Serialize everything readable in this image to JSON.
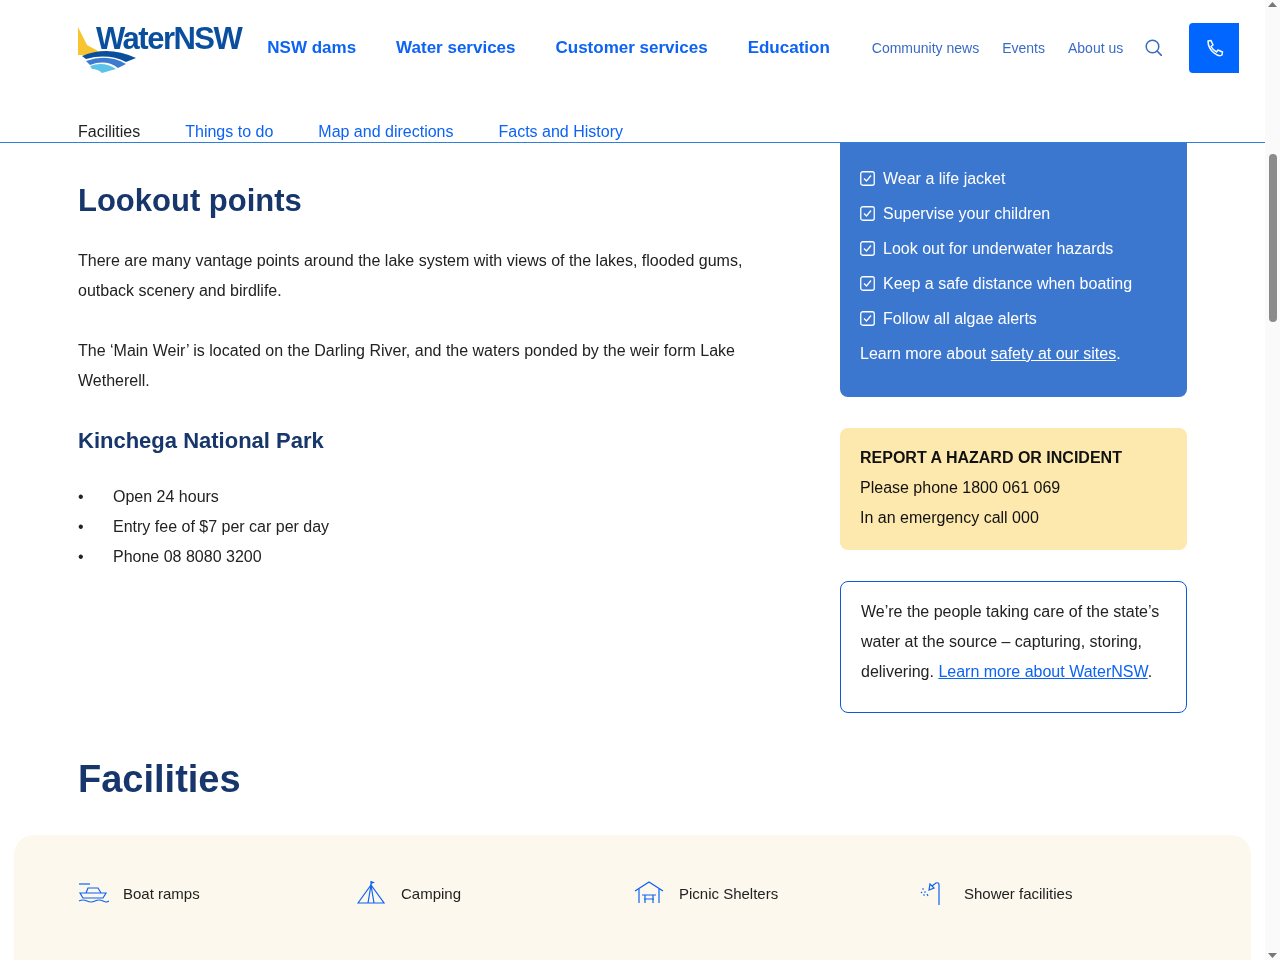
{
  "header": {
    "logo": "WaterNSW",
    "main_nav": [
      "NSW dams",
      "Water services",
      "Customer services",
      "Education"
    ],
    "secondary_nav": [
      "Community news",
      "Events",
      "About us"
    ]
  },
  "tabs": [
    {
      "label": "Facilities",
      "selected": true
    },
    {
      "label": "Things to do",
      "selected": false
    },
    {
      "label": "Map and directions",
      "selected": false
    },
    {
      "label": "Facts and History",
      "selected": false
    }
  ],
  "content": {
    "heading": "Lookout points",
    "paragraphs": [
      "There are many vantage points around the lake system with views of the lakes, flooded gums, outback scenery and birdlife.",
      "The ‘Main Weir’ is located on the Darling River, and the waters ponded by the weir form Lake Wetherell."
    ],
    "subheading": "Kinchega National Park",
    "bullets": [
      {
        "marker": "•",
        "text": "Open 24 hours"
      },
      {
        "marker": "•",
        "text": "Entry fee of $7 per car per day"
      },
      {
        "marker": "•",
        "text": "Phone 08 8080 3200"
      }
    ]
  },
  "safety_card": {
    "tips": [
      {
        "label": "Wear a life jacket",
        "checked": true
      },
      {
        "label": "Supervise your children",
        "checked": true
      },
      {
        "label": "Look out for underwater hazards",
        "checked": true
      },
      {
        "label": "Keep a safe distance when boating",
        "checked": true
      },
      {
        "label": "Follow all algae alerts",
        "checked": true
      }
    ],
    "note": {
      "text": "Learn more about ",
      "link": "safety at our sites",
      "end": "."
    }
  },
  "hazard_card": {
    "title": "REPORT A HAZARD OR INCIDENT",
    "lines": [
      "Please phone 1800 061 069",
      "In an emergency call 000"
    ]
  },
  "about_card": {
    "text": "We’re the people taking care of the state’s water at the source – capturing, storing, delivering. ",
    "link": "Learn more about WaterNSW",
    "end": "."
  },
  "facilities": {
    "heading": "Facilities",
    "items": [
      {
        "label": "Boat ramps",
        "kind": "boat"
      },
      {
        "label": "Camping",
        "kind": "tent"
      },
      {
        "label": "Picnic Shelters",
        "kind": "shelter"
      },
      {
        "label": "Shower facilities",
        "kind": "shower"
      }
    ]
  }
}
